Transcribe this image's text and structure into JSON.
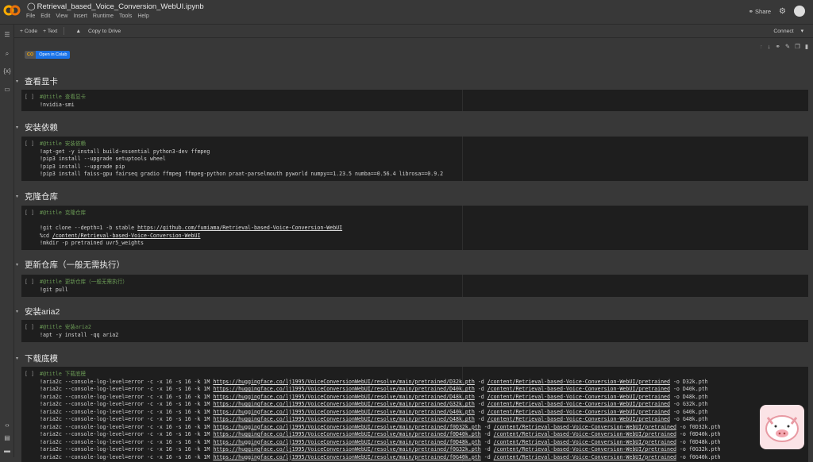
{
  "header": {
    "title": "Retrieval_based_Voice_Conversion_WebUI.ipynb",
    "menu": [
      "File",
      "Edit",
      "View",
      "Insert",
      "Runtime",
      "Tools",
      "Help"
    ],
    "share": "Share"
  },
  "toolbar": {
    "code": "+ Code",
    "text": "+ Text",
    "copy": "Copy to Drive",
    "connect": "Connect"
  },
  "badge": {
    "logo": "CO",
    "label": "Open in Colab"
  },
  "sections": [
    {
      "heading": "查看显卡",
      "lines": [
        [
          {
            "t": "#@title 查看显卡",
            "c": 1
          }
        ],
        [
          {
            "t": "!nvidia-smi"
          }
        ]
      ]
    },
    {
      "heading": "安装依赖",
      "lines": [
        [
          {
            "t": "#@title 安装依赖",
            "c": 1
          }
        ],
        [
          {
            "t": "!apt-get -y install build-essential python3-dev ffmpeg"
          }
        ],
        [
          {
            "t": "!pip3 install --upgrade setuptools wheel"
          }
        ],
        [
          {
            "t": "!pip3 install --upgrade pip"
          }
        ],
        [
          {
            "t": "!pip3 install faiss-gpu fairseq gradio ffmpeg ffmpeg-python praat-parselmouth pyworld numpy==1.23.5 numba==0.56.4 librosa==0.9.2"
          }
        ]
      ]
    },
    {
      "heading": "克隆仓库",
      "lines": [
        [
          {
            "t": "#@title 克隆仓库",
            "c": 1
          }
        ],
        [
          {
            "t": ""
          }
        ],
        [
          {
            "t": "!git clone --depth=1 -b stable "
          },
          {
            "t": "https://github.com/fumiama/Retrieval-based-Voice-Conversion-WebUI",
            "l": 1
          }
        ],
        [
          {
            "t": "%cd "
          },
          {
            "t": "/content/Retrieval-based-Voice-Conversion-WebUI",
            "l": 1
          }
        ],
        [
          {
            "t": "!mkdir -p pretrained uvr5_weights"
          }
        ]
      ]
    },
    {
      "heading": "更新仓库（一般无需执行）",
      "lines": [
        [
          {
            "t": "#@title 更新仓库（一般无需执行）",
            "c": 1
          }
        ],
        [
          {
            "t": "!git pull"
          }
        ]
      ]
    },
    {
      "heading": "安装aria2",
      "lines": [
        [
          {
            "t": "#@title 安装aria2",
            "c": 1
          }
        ],
        [
          {
            "t": "!apt -y install -qq aria2"
          }
        ]
      ]
    },
    {
      "heading": "下载底模",
      "lines": [
        [
          {
            "t": "#@title 下载底模",
            "c": 1
          }
        ]
      ],
      "aria": {
        "prefix": "!aria2c --console-log-level=error -c -x 16 -s 16 -k 1M ",
        "url": "https://huggingface.co/lj1995/VoiceConversionWebUI/resolve/main/pretrained/",
        "dir": "/content/Retrieval-based-Voice-Conversion-WebUI/pretrained",
        "files": [
          "D32k.pth",
          "D40k.pth",
          "D48k.pth",
          "G32k.pth",
          "G40k.pth",
          "G48k.pth",
          "f0D32k.pth",
          "f0D40k.pth",
          "f0D48k.pth",
          "f0G32k.pth",
          "f0G40k.pth"
        ]
      }
    }
  ],
  "run_marker": "[ ]"
}
